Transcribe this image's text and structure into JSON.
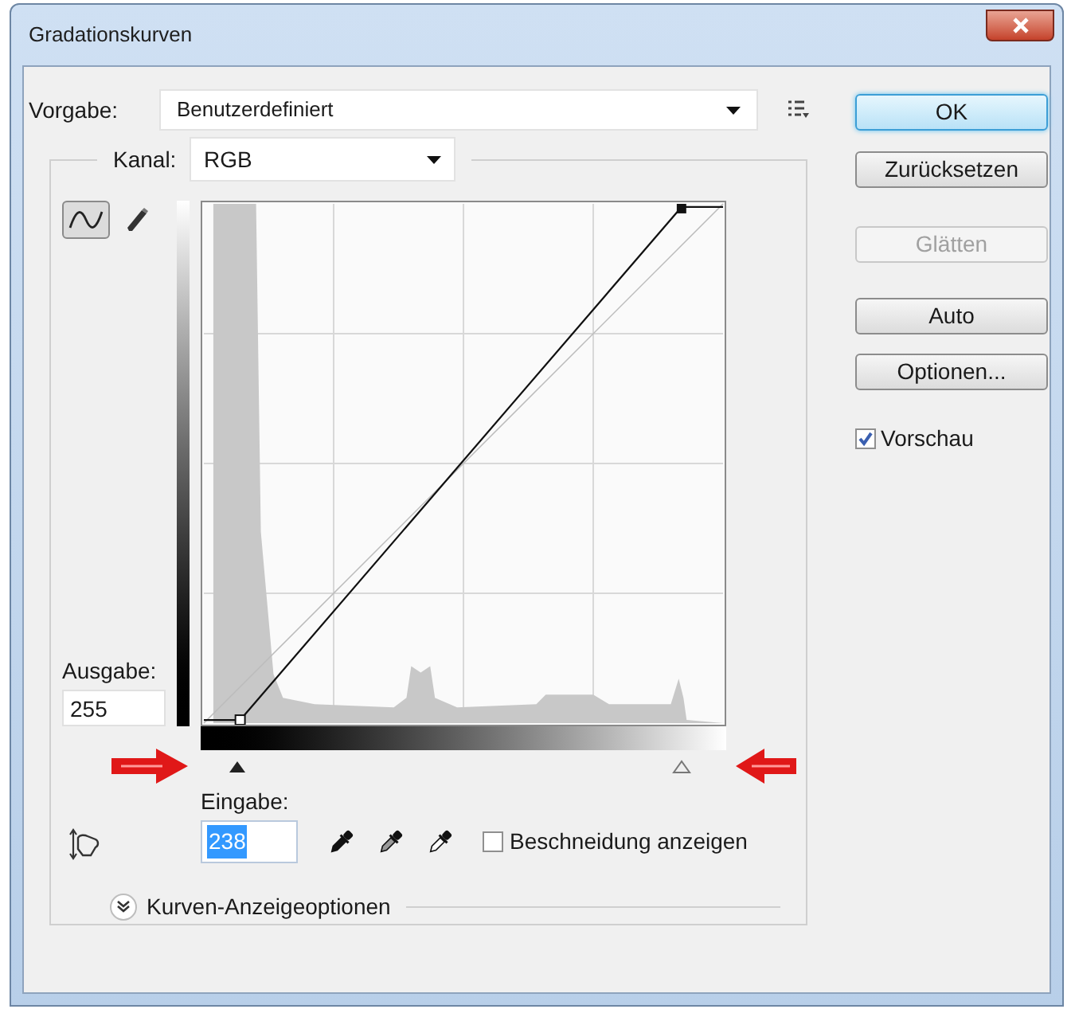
{
  "window": {
    "title": "Gradationskurven"
  },
  "preset": {
    "label": "Vorgabe:",
    "value": "Benutzerdefiniert"
  },
  "channel": {
    "label": "Kanal:",
    "value": "RGB"
  },
  "tools": [
    {
      "kind": "curve",
      "selected": true
    },
    {
      "kind": "pencil",
      "selected": false
    }
  ],
  "output": {
    "label": "Ausgabe:",
    "value": "255"
  },
  "input": {
    "label": "Eingabe:",
    "value": "238",
    "selected": true
  },
  "clipping": {
    "label": "Beschneidung anzeigen",
    "checked": false
  },
  "display_options": {
    "label": "Kurven-Anzeigeoptionen",
    "expanded": false
  },
  "buttons": [
    {
      "label": "OK",
      "kind": "default",
      "disabled": false
    },
    {
      "label": "Zurücksetzen",
      "kind": "normal",
      "disabled": false
    },
    {
      "label": "Glätten",
      "kind": "normal",
      "disabled": true
    },
    {
      "label": "Auto",
      "kind": "normal",
      "disabled": false
    },
    {
      "label": "Optionen...",
      "kind": "normal",
      "disabled": false
    }
  ],
  "preview": {
    "label": "Vorschau",
    "checked": true
  }
}
